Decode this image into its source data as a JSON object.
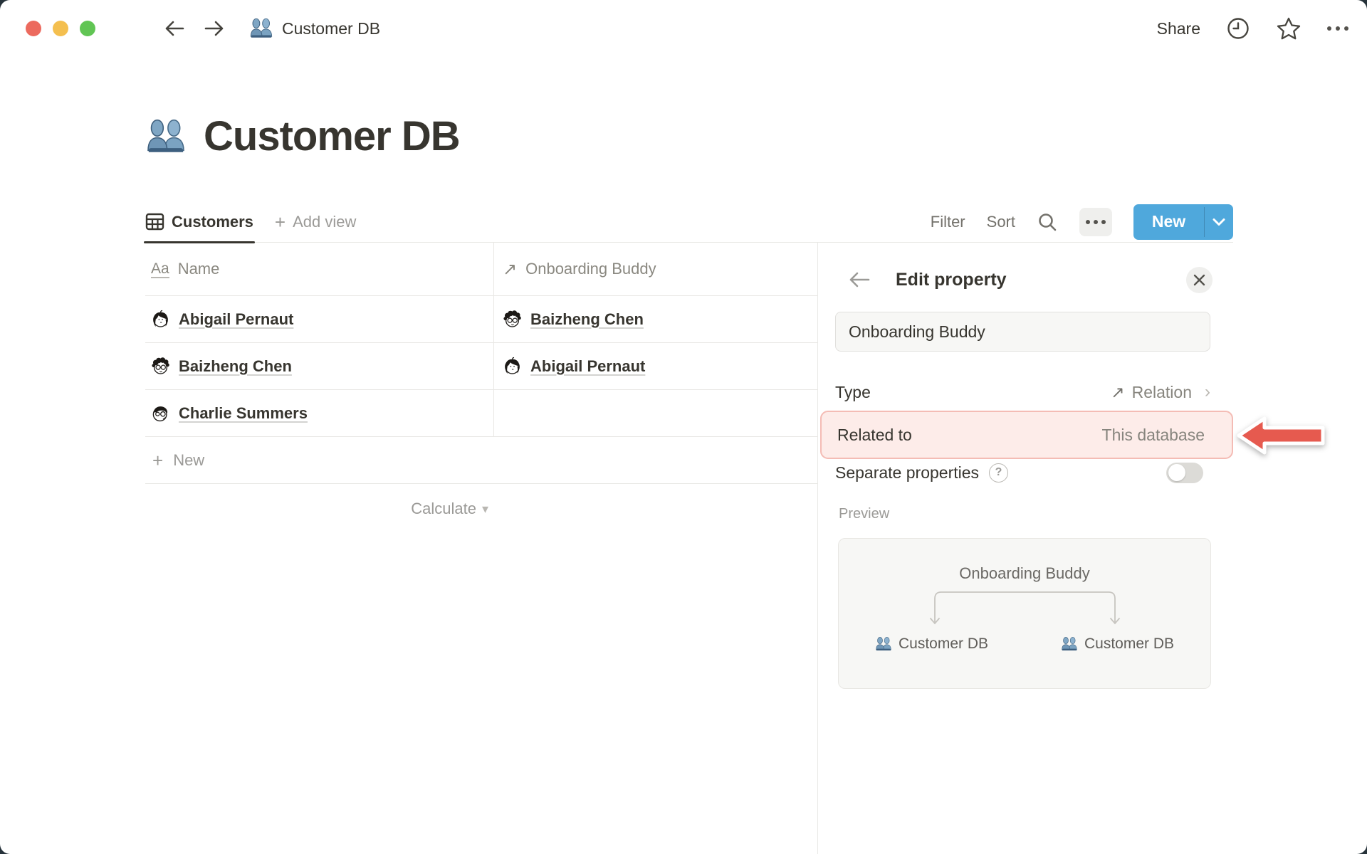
{
  "topbar": {
    "title": "Customer DB",
    "share_label": "Share"
  },
  "page": {
    "icon": "busts-in-silhouette",
    "title": "Customer DB"
  },
  "view_bar": {
    "active_tab": "Customers",
    "add_view_label": "Add view",
    "filter_label": "Filter",
    "sort_label": "Sort",
    "new_button_label": "New"
  },
  "table": {
    "columns": {
      "name": {
        "header": "Name",
        "type_icon": "Aa"
      },
      "buddy": {
        "header": "Onboarding Buddy",
        "type_icon": "relation-arrow"
      }
    },
    "rows": [
      {
        "name": "Abigail Pernaut",
        "buddy": "Baizheng Chen"
      },
      {
        "name": "Baizheng Chen",
        "buddy": "Abigail Pernaut"
      },
      {
        "name": "Charlie Summers",
        "buddy": ""
      }
    ],
    "new_row_label": "New",
    "calculate_label": "Calculate"
  },
  "panel": {
    "title": "Edit property",
    "name_input_value": "Onboarding Buddy",
    "type_row": {
      "label": "Type",
      "value": "Relation"
    },
    "related_row": {
      "label": "Related to",
      "value": "This database"
    },
    "separate_row": {
      "label": "Separate properties",
      "toggle_state": "off"
    },
    "preview": {
      "label": "Preview",
      "relation_title": "Onboarding Buddy",
      "left_db": "Customer DB",
      "right_db": "Customer DB"
    }
  },
  "colors": {
    "accent_blue": "#4FA8DC",
    "highlight_bg": "#FDECE9",
    "highlight_border": "#F4BCB5",
    "callout_arrow_red": "#E65A4F",
    "text_primary": "#37352F",
    "text_muted": "#9B9A97"
  }
}
